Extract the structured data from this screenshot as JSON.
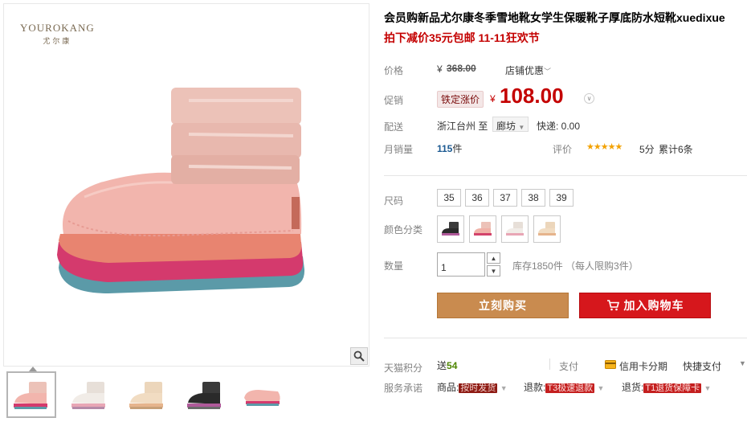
{
  "brand": {
    "name_en": "YOUROKANG",
    "name_cn": "尤尔康"
  },
  "gallery": {
    "zoom_icon": "magnifier-icon",
    "thumbs": [
      {
        "color": "pink",
        "active": true
      },
      {
        "color": "white",
        "active": false
      },
      {
        "color": "beige",
        "active": false
      },
      {
        "color": "black",
        "active": false
      },
      {
        "color": "pink-side",
        "active": false
      }
    ]
  },
  "product": {
    "title": "会员购新品尤尔康冬季雪地靴女学生保暖靴子厚底防水短靴xuedixue",
    "subtitle": "拍下减价35元包邮 11-11狂欢节"
  },
  "price": {
    "label": "价格",
    "currency": "¥",
    "original": "368.00",
    "shop_discount": "店铺优惠"
  },
  "promo": {
    "label": "促销",
    "tag": "铁定涨价",
    "currency": "¥",
    "price": "108.00"
  },
  "shipping": {
    "label": "配送",
    "from": "浙江台州",
    "to_word": "至",
    "destination": "廊坊",
    "fee": "快递: 0.00"
  },
  "sales": {
    "label": "月销量",
    "count": "115",
    "unit": "件",
    "rating_label": "评价",
    "stars": 5,
    "score": "5分",
    "total": "累计6条"
  },
  "sizes": {
    "label": "尺码",
    "options": [
      "35",
      "36",
      "37",
      "38",
      "39"
    ]
  },
  "colors": {
    "label": "颜色分类",
    "options": [
      {
        "name": "black",
        "body": "#2a2a2a",
        "sole": "#b05a9a"
      },
      {
        "name": "pink",
        "body": "#f0b2a8",
        "sole": "#d3436b"
      },
      {
        "name": "white",
        "body": "#f1ece7",
        "sole": "#e8a6b5"
      },
      {
        "name": "beige",
        "body": "#f1dcc2",
        "sole": "#e6b48c"
      }
    ]
  },
  "quantity": {
    "label": "数量",
    "value": "1",
    "stock": "库存1850件 （每人限购3件）"
  },
  "actions": {
    "buy_now": "立刻购买",
    "add_cart": "加入购物车"
  },
  "points": {
    "label": "天猫积分",
    "prefix": "送",
    "value": "54",
    "pay_label": "支付",
    "pay_card": "信用卡分期",
    "pay_fast": "快捷支付"
  },
  "service": {
    "label": "服务承诺",
    "item1_prefix": "商品:",
    "item1_tag": "按时发货",
    "item2_prefix": "退款:",
    "item2_tag": "T3极速退款",
    "item3_prefix": "退货:",
    "item3_tag": "T1退货保障卡"
  },
  "colors_ui": {
    "accent_red": "#c40000",
    "buy_button": "#c98b4f",
    "cart_button": "#d6171c"
  }
}
